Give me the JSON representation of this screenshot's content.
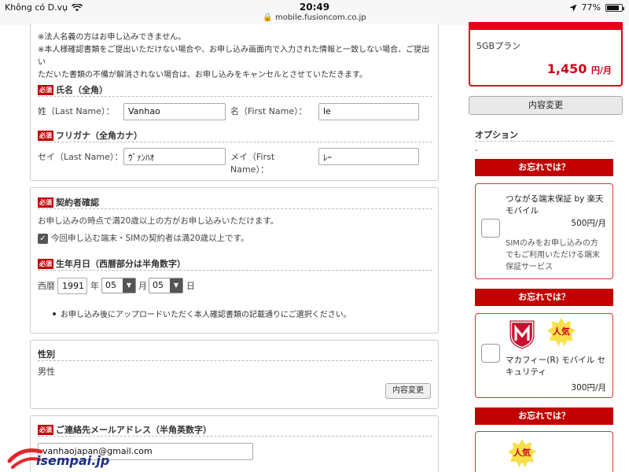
{
  "status_bar": {
    "carrier": "Không có D.vụ",
    "time": "20:49",
    "url": "mobile.fusioncom.co.jp",
    "battery": "77%"
  },
  "notes": {
    "line1": "※法人名義の方はお申し込みできません。",
    "line2": "※本人様確認書類をご提出いただけない場合や、お申し込み画面内で入力された情報と一致しない場合、ご提出い",
    "line3": "ただいた書類の不備が解消されない場合は、お申し込みをキャンセルとさせていただきます。"
  },
  "required_badge": "必須",
  "name": {
    "title": "氏名（全角）",
    "last_label": "姓（Last Name）：",
    "last_value": "Vanhao",
    "first_label": "名（First Name）：",
    "first_value": "le"
  },
  "furigana": {
    "title": "フリガナ（全角カナ）",
    "last_label": "セイ（Last Name）：",
    "last_value": "ｳﾞｧﾝﾊｵ",
    "first_label_1": "メイ（First",
    "first_label_2": "Name）：",
    "first_value": "ﾚｰ"
  },
  "contractor": {
    "title": "契約者確認",
    "desc": "お申し込みの時点で満20歳以上の方がお申し込みいただけます。",
    "checkbox_label": "今回申し込む端末・SIMの契約者は満20歳以上です。"
  },
  "birthday": {
    "title": "生年月日（西暦部分は半角数字）",
    "era_label": "西暦",
    "year": "1991",
    "year_unit": "年",
    "month": "05",
    "month_unit": "月",
    "day": "05",
    "day_unit": "日",
    "note": "お申し込み後にアップロードいただく本人確認書類の記載通りにご選択ください。"
  },
  "gender": {
    "title": "性別",
    "value": "男性",
    "change_button": "内容変更"
  },
  "email": {
    "title": "ご連絡先メールアドレス（半角英数字）",
    "value": "vanhaojapan@gmail.com"
  },
  "plan": {
    "name": "5GBプラン",
    "price": "1,450",
    "unit": "円/月"
  },
  "change_button": "内容変更",
  "options": {
    "title": "オプション",
    "dash": "-",
    "ribbon": "お忘れでは？",
    "item1": {
      "name_1": "つながる端末保証 by 楽天",
      "name_2": "モバイル",
      "price": "500円/月",
      "desc_1": "SIMのみをお申し込みの方",
      "desc_2": "でもご利用いただける端末",
      "desc_3": "保証サービス"
    },
    "item2": {
      "badge": "人気",
      "name_1": "マカフィー(R) モバイル セ",
      "name_2": "キュリティ",
      "price": "300円/月"
    },
    "item3": {
      "badge": "人気"
    }
  },
  "watermark": "isempai.jp",
  "colors": {
    "accent_red": "#c20000",
    "price_red": "#d0001a",
    "watermark_blue": "#1b2f88"
  }
}
